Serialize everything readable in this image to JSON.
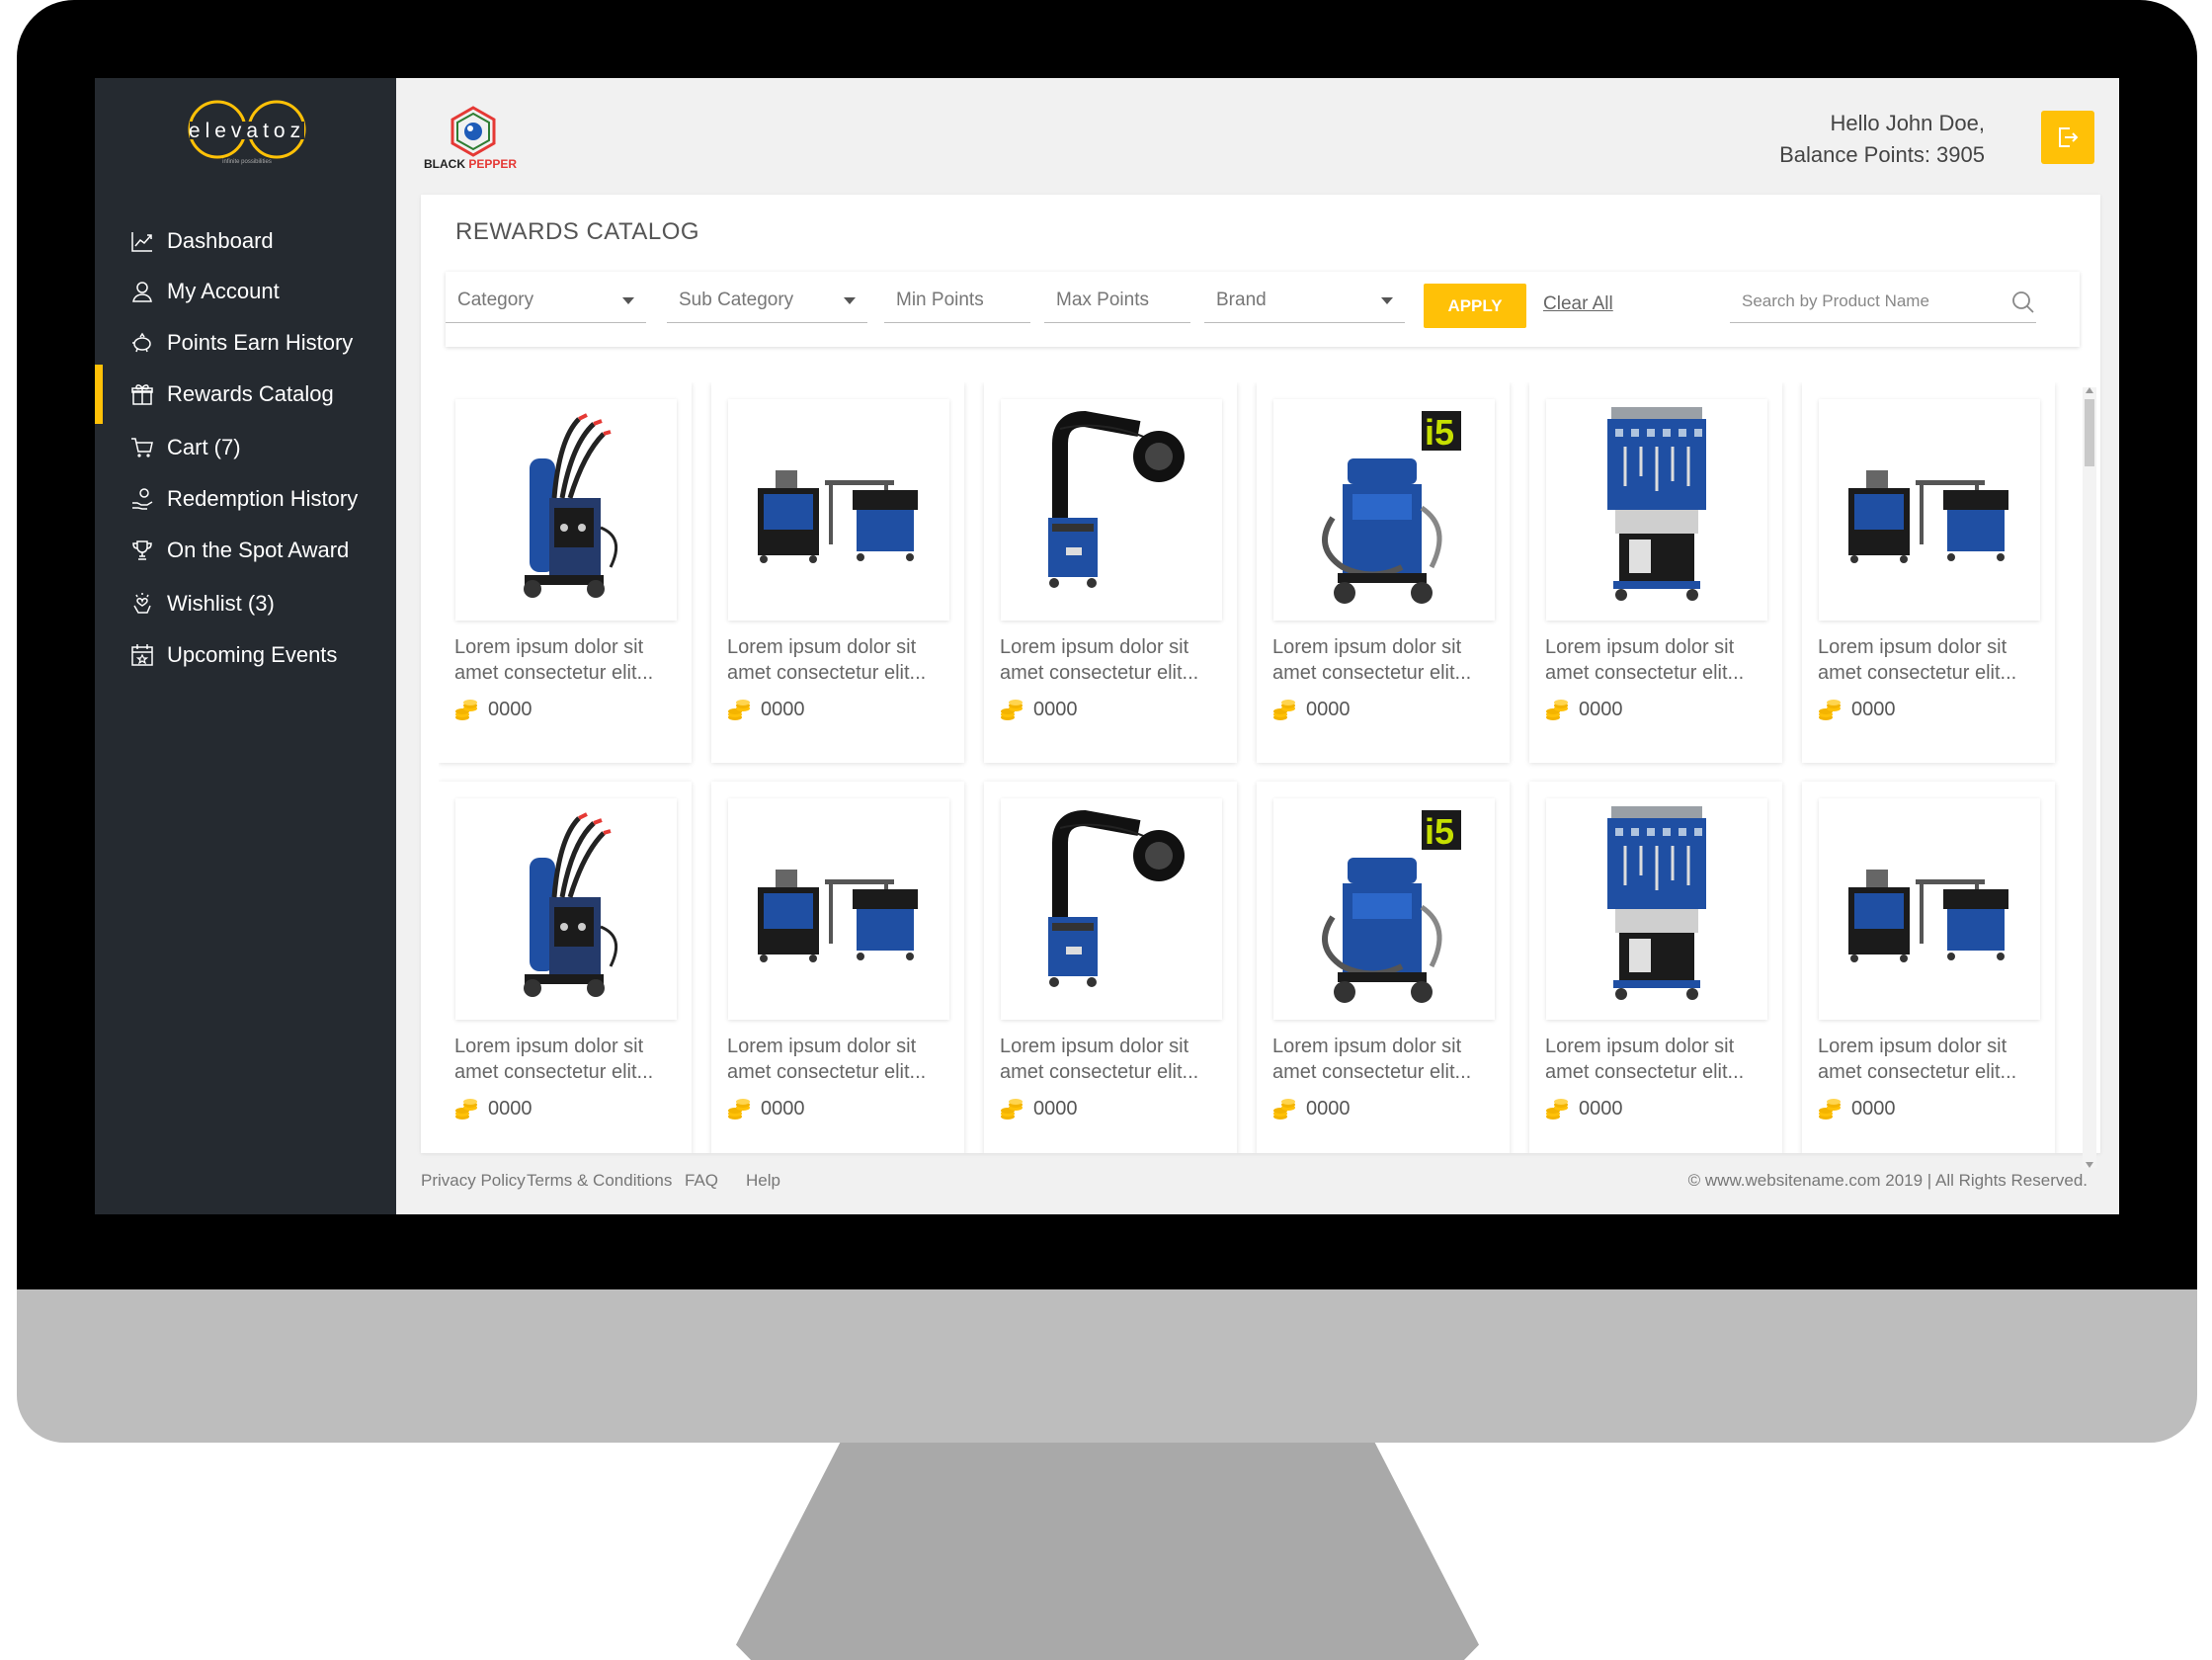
{
  "app": {
    "logo_text": "elevatoz",
    "logo_tagline": "infinite possibilities",
    "brand_logo_text_1": "BLACK",
    "brand_logo_text_2": "PEPPER"
  },
  "colors": {
    "accent": "#ffc107",
    "sidebar_bg": "#252a30",
    "product_blue": "#1f4fa3"
  },
  "sidebar": {
    "items": [
      {
        "label": "Dashboard",
        "icon": "chart-line-icon",
        "active": false
      },
      {
        "label": "My Account",
        "icon": "user-icon",
        "active": false
      },
      {
        "label": "Points Earn History",
        "icon": "piggy-bank-icon",
        "active": false
      },
      {
        "label": "Rewards Catalog",
        "icon": "gift-icon",
        "active": true
      },
      {
        "label": "Cart (7)",
        "icon": "cart-icon",
        "active": false
      },
      {
        "label": "Redemption History",
        "icon": "hand-coin-icon",
        "active": false
      },
      {
        "label": "On the Spot Award",
        "icon": "trophy-icon",
        "active": false
      },
      {
        "label": "Wishlist (3)",
        "icon": "hand-heart-icon",
        "active": false
      },
      {
        "label": "Upcoming Events",
        "icon": "calendar-icon",
        "active": false
      }
    ]
  },
  "header": {
    "greeting": "Hello John Doe,",
    "balance": "Balance Points: 3905",
    "logout_icon": "logout-icon"
  },
  "catalog": {
    "title": "REWARDS CATALOG",
    "filters": {
      "category": "Category",
      "sub_category": "Sub Category",
      "min_points": "Min Points",
      "max_points": "Max Points",
      "brand": "Brand",
      "apply": "APPLY",
      "clear": "Clear All",
      "search_placeholder": "Search by Product Name"
    },
    "products": [
      {
        "title": "Lorem ipsum dolor sit amet consectetur elit...",
        "points": "0000",
        "image": "welding-machine"
      },
      {
        "title": "Lorem ipsum dolor sit amet consectetur elit...",
        "points": "0000",
        "image": "workstation-set"
      },
      {
        "title": "Lorem ipsum dolor sit amet consectetur elit...",
        "points": "0000",
        "image": "fume-extractor"
      },
      {
        "title": "Lorem ipsum dolor sit amet consectetur elit...",
        "points": "0000",
        "image": "spot-welder-i5"
      },
      {
        "title": "Lorem ipsum dolor sit amet consectetur elit...",
        "points": "0000",
        "image": "tool-board-station"
      },
      {
        "title": "Lorem ipsum dolor sit amet consectetur elit...",
        "points": "0000",
        "image": "workstation-set"
      },
      {
        "title": "Lorem ipsum dolor sit amet consectetur elit...",
        "points": "0000",
        "image": "welding-machine"
      },
      {
        "title": "Lorem ipsum dolor sit amet consectetur elit...",
        "points": "0000",
        "image": "workstation-set"
      },
      {
        "title": "Lorem ipsum dolor sit amet consectetur elit...",
        "points": "0000",
        "image": "fume-extractor"
      },
      {
        "title": "Lorem ipsum dolor sit amet consectetur elit...",
        "points": "0000",
        "image": "spot-welder-i5"
      },
      {
        "title": "Lorem ipsum dolor sit amet consectetur elit...",
        "points": "0000",
        "image": "tool-board-station"
      },
      {
        "title": "Lorem ipsum dolor sit amet consectetur elit...",
        "points": "0000",
        "image": "workstation-set"
      }
    ]
  },
  "footer": {
    "links": [
      "Privacy Policy",
      "Terms & Conditions",
      "FAQ",
      "Help"
    ],
    "copyright": "© www.websitename.com 2019  |  All Rights Reserved."
  }
}
